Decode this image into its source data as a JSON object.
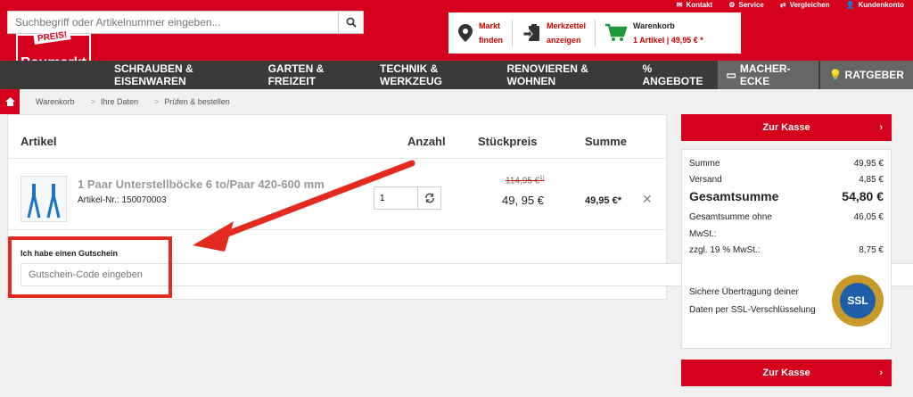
{
  "header": {
    "top_links": [
      "Kontakt",
      "Service",
      "Vergleichen",
      "Kundenkonto"
    ],
    "search_placeholder": "Suchbegriff oder Artikelnummer eingeben...",
    "logo_text": "Baumarkt",
    "logo_badge": "PREIS!",
    "market": {
      "line1": "Markt",
      "line2": "finden"
    },
    "wishlist": {
      "line1": "Merkzettel",
      "line2": "anzeigen"
    },
    "cart": {
      "line1": "Warenkorb",
      "line2": "1 Artikel | 49,95 € *"
    }
  },
  "nav": {
    "items": [
      "SCHRAUBEN & EISENWAREN",
      "GARTEN & FREIZEIT",
      "TECHNIK & WERKZEUG",
      "RENOVIEREN & WOHNEN",
      "% ANGEBOTE",
      "MACHER-ECKE",
      "RATGEBER"
    ]
  },
  "breadcrumb": [
    "Warenkorb",
    "Ihre Daten",
    "Prüfen & bestellen"
  ],
  "cart": {
    "headers": {
      "article": "Artikel",
      "qty": "Anzahl",
      "unit": "Stückpreis",
      "sum": "Summe"
    },
    "item": {
      "title": "1 Paar Unterstellböcke 6 to/Paar 420-600 mm",
      "number": "Artikel-Nr.: 150070003",
      "qty": "1",
      "old_price": "114,95 €",
      "old_price_note": "1)",
      "price": "49, 95 €",
      "sum": "49,95 €*"
    },
    "voucher": {
      "label": "Ich habe einen Gutschein",
      "placeholder": "Gutschein-Code eingeben"
    }
  },
  "summary": {
    "checkout_label": "Zur Kasse",
    "rows": {
      "summe_label": "Summe",
      "summe": "49,95 €",
      "versand_label": "Versand",
      "versand": "4,85 €",
      "gesamt_label": "Gesamtsumme",
      "gesamt": "54,80 €",
      "ohne_label1": "Gesamtsumme ohne",
      "ohne_label2": "MwSt.:",
      "ohne": "46,05 €",
      "mwst_label": "zzgl. 19 % MwSt.:",
      "mwst": "8,75 €"
    },
    "ssl_text": "Sichere Übertragung deiner Daten per SSL-Verschlüsselung",
    "seal_text": "SSL"
  },
  "colors": {
    "brand": "#d5001c",
    "nav": "#3a3a3a",
    "annotation": "#e32a1e"
  }
}
